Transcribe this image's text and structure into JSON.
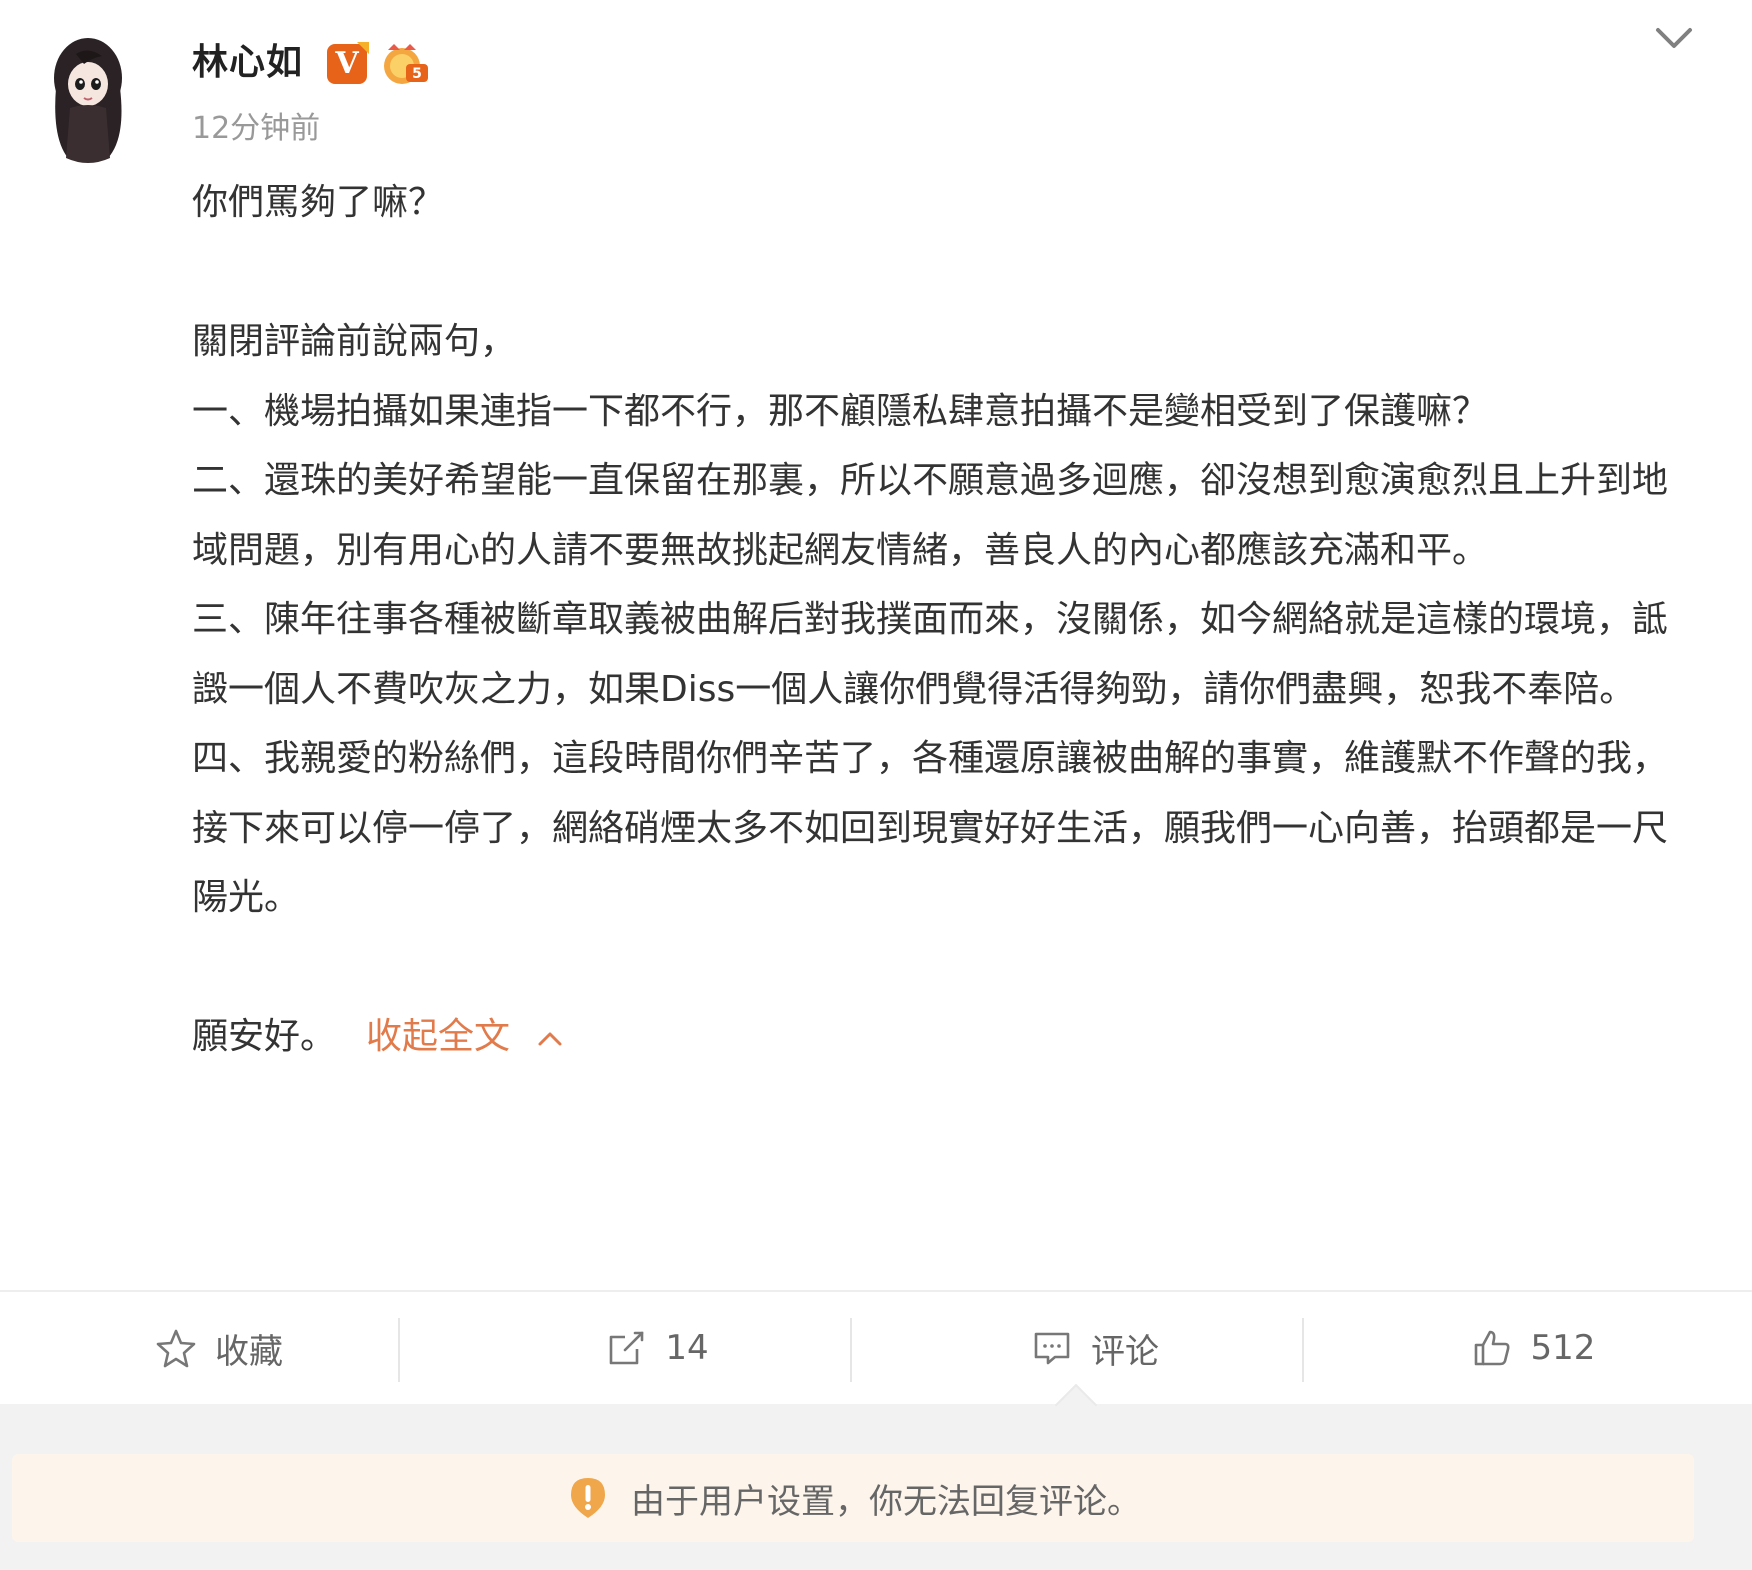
{
  "post": {
    "author": "林心如",
    "verified_badge": "V",
    "time": "12分钟前",
    "paragraphs": [
      "你們罵夠了嘛？",
      "",
      "關閉評論前說兩句，",
      "一、機場拍攝如果連指一下都不行，那不顧隱私肆意拍攝不是變相受到了保護嘛？",
      "二、還珠的美好希望能一直保留在那裏，所以不願意過多迴應，卻沒想到愈演愈烈且上升到地域問題，別有用心的人請不要無故挑起網友情緒，善良人的內心都應該充滿和平。",
      "三、陳年往事各種被斷章取義被曲解后對我撲面而來，沒關係，如今網絡就是這樣的環境，詆譭一個人不費吹灰之力，如果Diss一個人讓你們覺得活得夠勁，請你們盡興，恕我不奉陪。",
      "四、我親愛的粉絲們，這段時間你們辛苦了，各種還原讓被曲解的事實，維護默不作聲的我，接下來可以停一停了，網絡硝煙太多不如回到現實好好生活，願我們一心向善，抬頭都是一尺陽光。",
      ""
    ],
    "closing": "願安好。",
    "collapse_link": "收起全文",
    "link_color": "#e27b4b"
  },
  "actions": {
    "favorite": {
      "label": "收藏",
      "icon": "star-icon"
    },
    "repost": {
      "label": "14",
      "icon": "share-icon"
    },
    "comment": {
      "label": "评论",
      "icon": "comment-icon"
    },
    "like": {
      "label": "512",
      "icon": "thumbs-up-icon"
    }
  },
  "notice": {
    "text": "由于用户设置，你无法回复评论。",
    "icon": "warning-icon",
    "icon_color": "#f0a64a"
  }
}
